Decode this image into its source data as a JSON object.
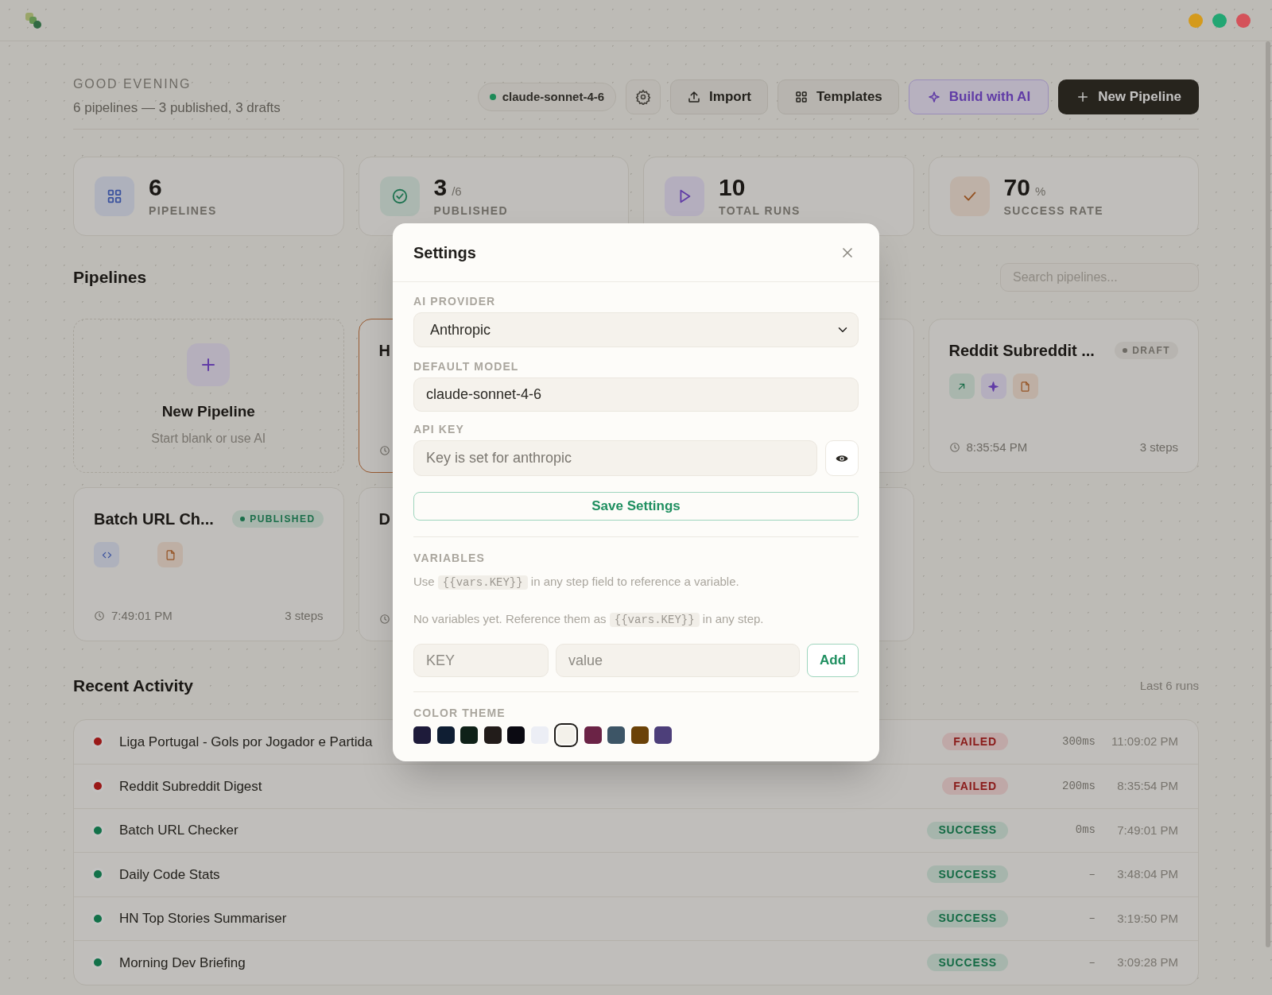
{
  "window": {
    "controls": [
      {
        "color": "#d49a1c"
      },
      {
        "color": "#22a673"
      },
      {
        "color": "#d4525a"
      }
    ]
  },
  "header": {
    "greeting": "GOOD EVENING",
    "summary": "6 pipelines — 3 published, 3 drafts",
    "model": "claude-sonnet-4-6",
    "buttons": [
      {
        "kind": "settings"
      },
      {
        "kind": "import",
        "label": "Import"
      },
      {
        "kind": "templates",
        "label": "Templates"
      },
      {
        "kind": "ai",
        "label": "Build with AI"
      },
      {
        "kind": "primary",
        "label": "New Pipeline"
      }
    ]
  },
  "stats": [
    {
      "kind": "grid",
      "value": "6",
      "label": "PIPELINES"
    },
    {
      "kind": "published",
      "value": "3",
      "suffix": "/6",
      "label": "PUBLISHED"
    },
    {
      "kind": "runs",
      "value": "10",
      "label": "TOTAL RUNS"
    },
    {
      "kind": "rate",
      "value": "70",
      "suffix": "%",
      "label": "SUCCESS RATE"
    }
  ],
  "pipelines": {
    "title": "Pipelines",
    "search": {
      "placeholder": "Search pipelines..."
    },
    "cards": [
      {
        "kind": "new",
        "title": "New Pipeline",
        "subtitle": "Start blank or use AI",
        "selected": false
      },
      {
        "kind": "pipeline",
        "title": "H",
        "selected": true
      },
      {
        "kind": "pipeline",
        "selected": false
      },
      {
        "kind": "pipeline",
        "title": "Reddit Subreddit ...",
        "badge": {
          "label": "DRAFT",
          "kind": "draft"
        },
        "steps": [
          {
            "kind": "arrow"
          },
          {
            "kind": "sparkle"
          },
          {
            "kind": "file"
          }
        ],
        "time": "8:35:54 PM",
        "step_count": "3 steps",
        "selected": false
      },
      {
        "kind": "pipeline",
        "title": "Batch URL Ch...",
        "badge": {
          "label": "PUBLISHED",
          "kind": "published"
        },
        "steps": [
          {
            "kind": "code"
          },
          {
            "kind": "gap"
          },
          {
            "kind": "file"
          }
        ],
        "time": "7:49:01 PM",
        "step_count": "3 steps",
        "selected": false
      },
      {
        "kind": "pipeline",
        "title": "D",
        "selected": false
      },
      {
        "kind": "pipeline",
        "selected": false
      }
    ]
  },
  "activity": {
    "title": "Recent Activity",
    "caption": "Last 6 runs",
    "runs": [
      {
        "name": "Liga Portugal - Gols por Jogador e Partida",
        "kind": "failed",
        "badge": "FAILED",
        "duration": "300ms",
        "time": "11:09:02 PM"
      },
      {
        "name": "Reddit Subreddit Digest",
        "kind": "failed",
        "badge": "FAILED",
        "duration": "200ms",
        "time": "8:35:54 PM"
      },
      {
        "name": "Batch URL Checker",
        "kind": "success",
        "badge": "SUCCESS",
        "duration": "0ms",
        "time": "7:49:01 PM"
      },
      {
        "name": "Daily Code Stats",
        "kind": "success",
        "badge": "SUCCESS",
        "duration": "–",
        "time": "3:48:04 PM"
      },
      {
        "name": "HN Top Stories Summariser",
        "kind": "success",
        "badge": "SUCCESS",
        "duration": "–",
        "time": "3:19:50 PM"
      },
      {
        "name": "Morning Dev Briefing",
        "kind": "success",
        "badge": "SUCCESS",
        "duration": "–",
        "time": "3:09:28 PM"
      }
    ]
  },
  "settings": {
    "title": "Settings",
    "provider": {
      "label": "AI PROVIDER",
      "value": "Anthropic"
    },
    "model": {
      "label": "DEFAULT MODEL",
      "value": "claude-sonnet-4-6"
    },
    "api_key": {
      "label": "API KEY",
      "placeholder": "Key is set for anthropic"
    },
    "save": "Save Settings",
    "variables": {
      "label": "VARIABLES",
      "hint": {
        "before": "Use",
        "code": "{{vars.KEY}}",
        "after": "in any step field to reference a variable."
      },
      "empty": {
        "before": "No variables yet. Reference them as",
        "code": "{{vars.KEY}}",
        "after": "in any step."
      },
      "key_placeholder": "KEY",
      "value_placeholder": "value",
      "add": "Add"
    },
    "theme": {
      "label": "COLOR THEME",
      "swatches": [
        {
          "color": "#1e1b3a",
          "selected": false
        },
        {
          "color": "#0f1e33",
          "selected": false
        },
        {
          "color": "#0f2118",
          "selected": false
        },
        {
          "color": "#221c1a",
          "selected": false
        },
        {
          "color": "#0b0a12",
          "selected": false
        },
        {
          "color": "#eceef5",
          "selected": false
        },
        {
          "color": "#f3f1ea",
          "selected": true
        },
        {
          "color": "#6b2346",
          "selected": false
        },
        {
          "color": "#3d5566",
          "selected": false
        },
        {
          "color": "#6b4208",
          "selected": false
        },
        {
          "color": "#4d3f7a",
          "selected": false
        }
      ]
    }
  }
}
